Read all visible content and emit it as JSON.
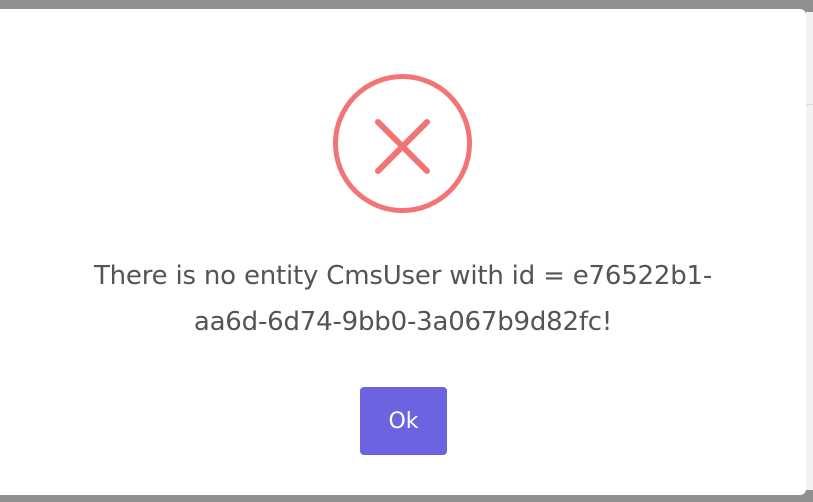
{
  "dialog": {
    "message": "There is no entity CmsUser with id = e76522b1-aa6d-6d74-9bb0-3a067b9d82fc!",
    "confirm_label": "Ok",
    "icon": "error-x-icon"
  },
  "colors": {
    "error": "#f27474",
    "confirm_button": "#6c63e0",
    "message_text": "#545454",
    "overlay": "#8f8f8f"
  }
}
